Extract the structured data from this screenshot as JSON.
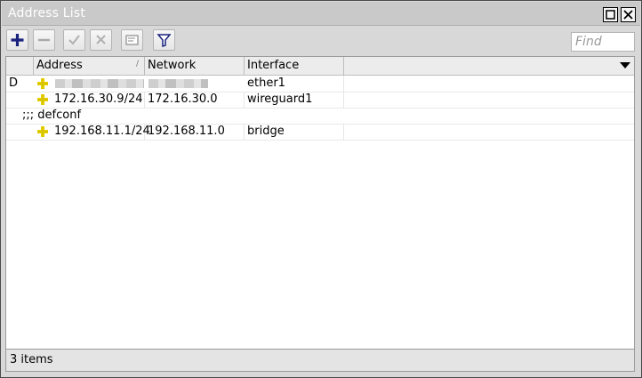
{
  "window": {
    "title": "Address List"
  },
  "toolbar": {
    "buttons": [
      {
        "name": "add-icon"
      },
      {
        "name": "remove-icon"
      },
      {
        "name": "enable-icon"
      },
      {
        "name": "disable-icon"
      },
      {
        "name": "comment-icon"
      },
      {
        "name": "filter-icon"
      }
    ],
    "find_placeholder": "Find"
  },
  "table": {
    "columns": [
      "Address",
      "Network",
      "Interface"
    ],
    "rows": [
      {
        "flag": "D",
        "address": "",
        "network": "",
        "interface": "ether1",
        "address_obscured": true
      },
      {
        "flag": "",
        "address": "172.16.30.9/24",
        "network": "172.16.30.0",
        "interface": "wireguard1"
      },
      {
        "comment": ";;; defconf"
      },
      {
        "flag": "",
        "address": "192.168.11.1/24",
        "network": "192.168.11.0",
        "interface": "bridge"
      }
    ]
  },
  "status": {
    "text": "3 items"
  },
  "colors": {
    "add_icon": "#1a237e",
    "address_icon": "#e8d200"
  }
}
